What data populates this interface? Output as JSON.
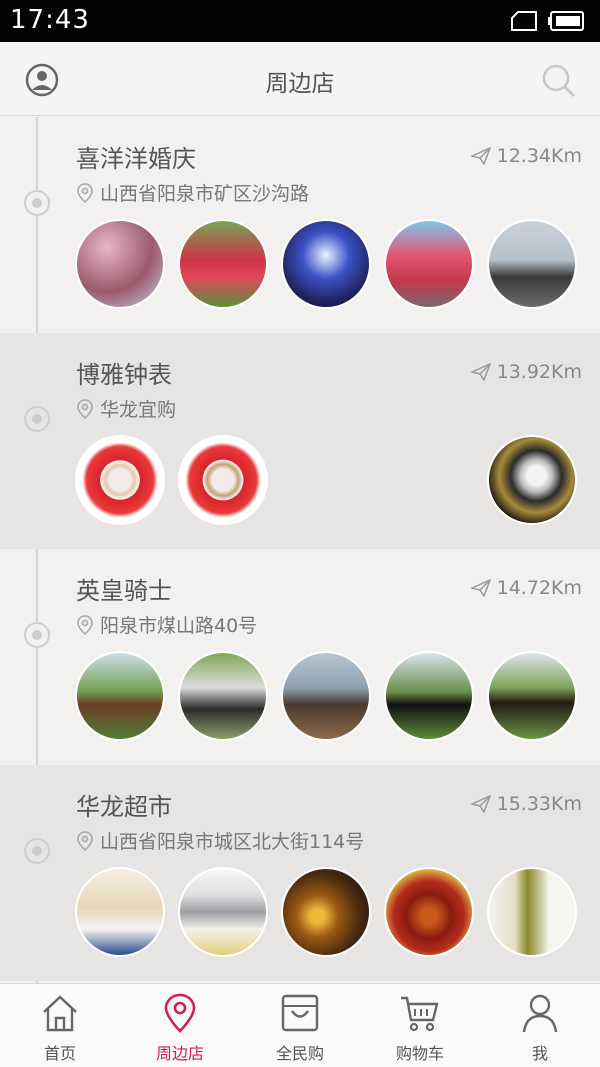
{
  "status_bar": {
    "time": "17:43"
  },
  "header": {
    "title": "周边店"
  },
  "stores": [
    {
      "name": "喜洋洋婚庆",
      "distance": "12.34Km",
      "address": "山西省阳泉市矿区沙沟路"
    },
    {
      "name": "博雅钟表",
      "distance": "13.92Km",
      "address": "华龙宜购"
    },
    {
      "name": "英皇骑士",
      "distance": "14.72Km",
      "address": "阳泉市煤山路40号"
    },
    {
      "name": "华龙超市",
      "distance": "15.33Km",
      "address": "山西省阳泉市城区北大街114号"
    }
  ],
  "tabbar": {
    "items": [
      {
        "label": "首页",
        "icon": "home-icon"
      },
      {
        "label": "周边店",
        "icon": "location-pin-icon",
        "active": true
      },
      {
        "label": "全民购",
        "icon": "shopping-bag-icon"
      },
      {
        "label": "购物车",
        "icon": "cart-icon"
      },
      {
        "label": "我",
        "icon": "person-icon"
      }
    ]
  },
  "colors": {
    "accent": "#d2204f",
    "status_bar": "#050505",
    "alt_row": "#e6e5e4"
  }
}
